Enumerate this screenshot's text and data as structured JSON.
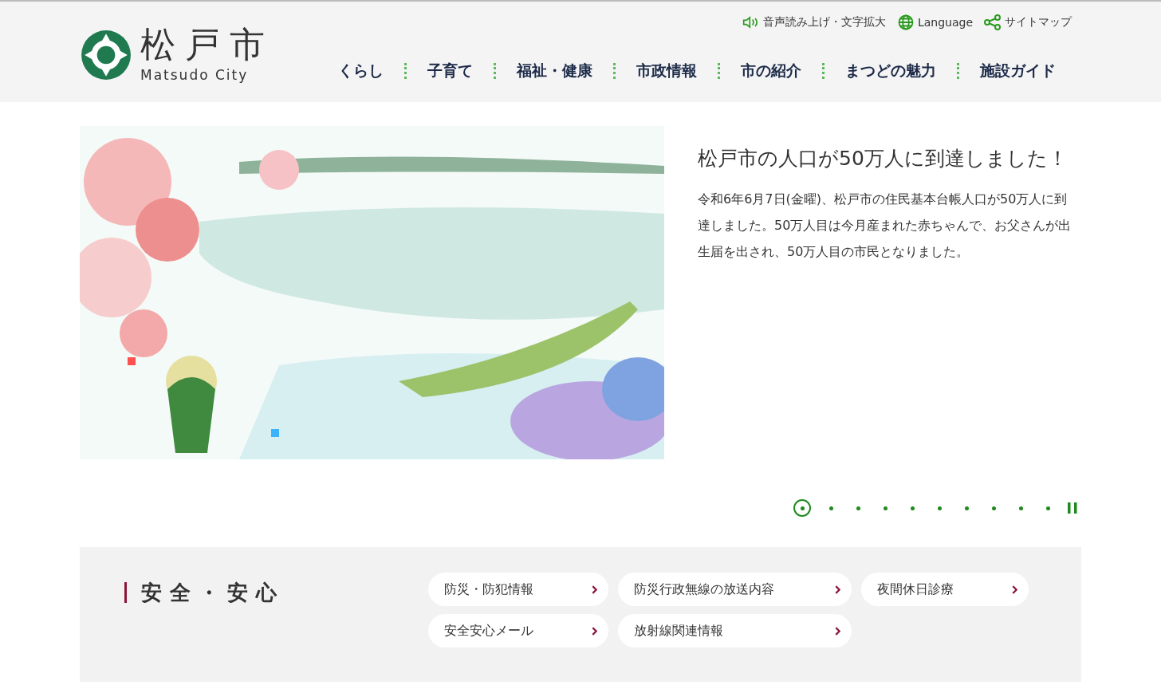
{
  "header": {
    "logo": {
      "name": "松戸市",
      "subtitle": "Matsudo City"
    },
    "utility_links": [
      {
        "kind": "speaker",
        "label": "音声読み上げ・文字拡大"
      },
      {
        "kind": "globe",
        "label": "Language"
      },
      {
        "kind": "share",
        "label": "サイトマップ"
      }
    ],
    "nav": [
      "くらし",
      "子育て",
      "福祉・健康",
      "市政情報",
      "市の紹介",
      "まつどの魅力",
      "施設ガイド"
    ]
  },
  "feature": {
    "title": "松戸市の人口が50万人に到達しました！",
    "body": "令和6年6月7日(金曜)、松戸市の住民基本台帳人口が50万人に到達しました。50万人目は今月産まれた赤ちゃんで、お父さんが出生届を出され、50万人目の市民となりました。"
  },
  "carousel": {
    "slides": [
      {
        "selected": true
      },
      {
        "selected": false
      },
      {
        "selected": false
      },
      {
        "selected": false
      },
      {
        "selected": false
      },
      {
        "selected": false
      },
      {
        "selected": false
      },
      {
        "selected": false
      },
      {
        "selected": false
      },
      {
        "selected": false
      }
    ],
    "paused": false
  },
  "safety": {
    "heading": "安全・安心",
    "links": [
      "防災・防犯情報",
      "防災行政無線の放送内容",
      "夜間休日診療",
      "安全安心メール",
      "放射線関連情報"
    ]
  }
}
